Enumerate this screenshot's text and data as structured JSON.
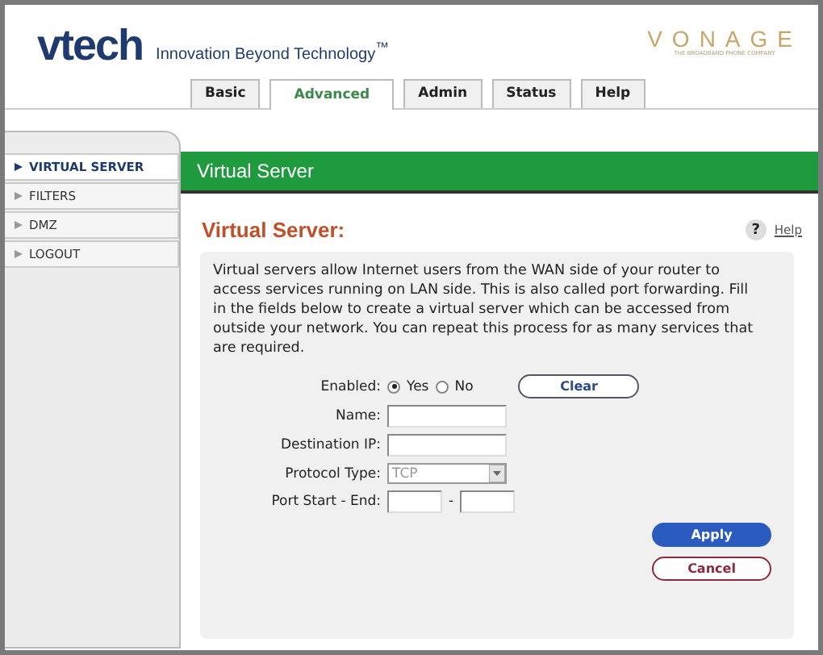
{
  "header": {
    "logo": "vtech",
    "tagline": "Innovation Beyond Technology$^{™}$",
    "brand": "VONAGE",
    "brand_tagline": "THE BROADBAND PHONE COMPANY"
  },
  "tabs": [
    {
      "label": "Basic",
      "selected": false
    },
    {
      "label": "Advanced",
      "selected": true
    },
    {
      "label": "Admin",
      "selected": false
    },
    {
      "label": "Status",
      "selected": false
    },
    {
      "label": "Help",
      "selected": false
    }
  ],
  "sidebar": {
    "items": [
      {
        "label": "VIRTUAL SERVER",
        "selected": true
      },
      {
        "label": "FILTERS",
        "selected": false
      },
      {
        "label": "DMZ",
        "selected": false
      },
      {
        "label": "LOGOUT",
        "selected": false
      }
    ]
  },
  "section_bar": {
    "title": "Virtual Server"
  },
  "panel": {
    "heading": "Virtual Server:",
    "help_icon": "?",
    "help_link": "Help",
    "description": "Virtual servers allow Internet users from the WAN side of your router to access services running on LAN side. This is also called port forwarding. Fill in the fields below to create a virtual server which can be accessed from outside your network. You can repeat this process for as many services that are required.",
    "fields": [
      {
        "kind": "radio",
        "label": "Enabled:",
        "options": [
          {
            "label": "Yes",
            "selected": true
          },
          {
            "label": "No",
            "selected": false
          }
        ],
        "button": "Clear"
      },
      {
        "kind": "text",
        "label": "Name:"
      },
      {
        "kind": "text",
        "label": "Destination IP:"
      },
      {
        "kind": "select",
        "label": "Protocol Type:",
        "value": "TCP",
        "disabled": true
      },
      {
        "kind": "range",
        "label": "Port Start - End:",
        "separator": "-"
      }
    ],
    "buttons": [
      {
        "kind": "primary",
        "label": "Apply"
      },
      {
        "kind": "secondary",
        "label": "Cancel"
      }
    ]
  }
}
